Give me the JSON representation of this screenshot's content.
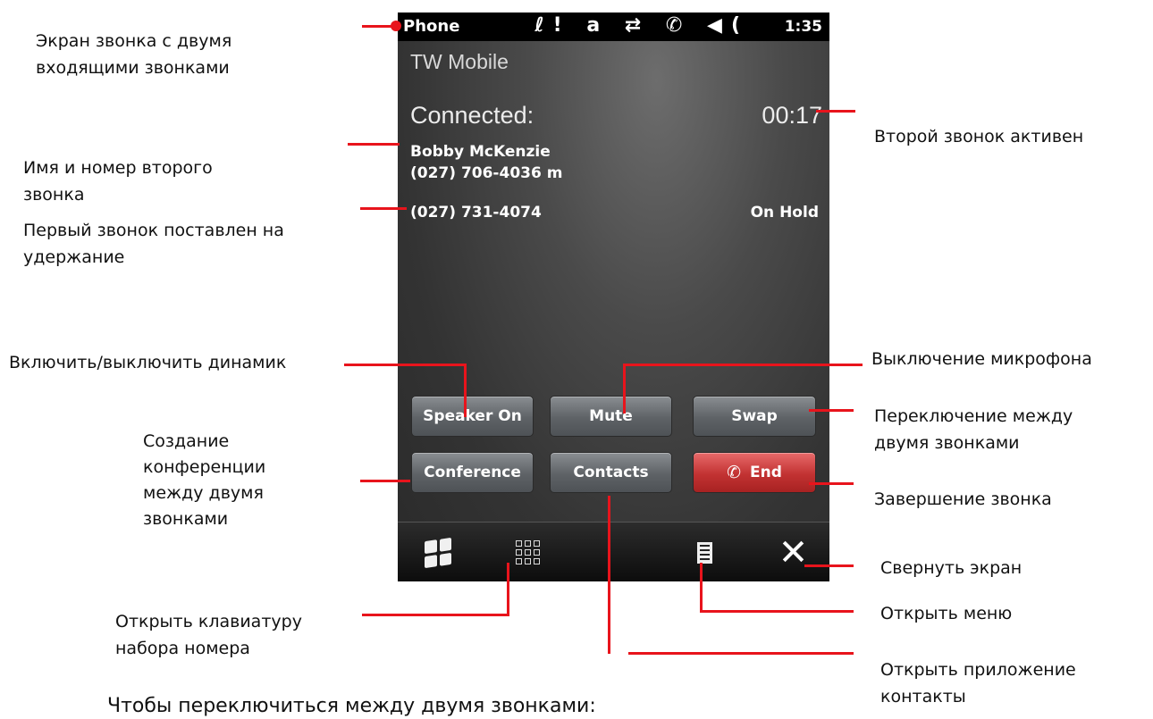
{
  "phone": {
    "status_title": "Phone",
    "status_icons": "ℓ! a ⇄ ✆ ◀(",
    "clock": "1:35",
    "carrier": "TW Mobile",
    "connected_label": "Connected:",
    "call_timer": "00:17",
    "active_call_name": "Bobby McKenzie",
    "active_call_number": "(027) 706-4036 m",
    "held_call_number": "(027) 731-4074",
    "held_status": "On Hold",
    "buttons": {
      "speaker": "Speaker On",
      "mute": "Mute",
      "swap": "Swap",
      "conference": "Conference",
      "contacts": "Contacts",
      "end": "End"
    },
    "toolbar_icons": [
      "windows-start-icon",
      "keypad-icon",
      "menu-icon",
      "close-icon"
    ]
  },
  "annotations": {
    "screen_l1": "Экран звонка с двумя",
    "screen_l2": "входящими звонками",
    "second_active": "Второй звонок активен",
    "name_l1": "Имя и номер второго",
    "name_l2": "звонка",
    "hold_l1": "Первый звонок поставлен на",
    "hold_l2": "удержание",
    "speaker": "Включить/выключить динамик",
    "mute": "Выключение микрофона",
    "swap_l1": "Переключение между",
    "swap_l2": "двумя звонками",
    "conf_l1": "Создание",
    "conf_l2": "конференции",
    "conf_l3": "между двумя",
    "conf_l4": "звонками",
    "end": "Завершение звонка",
    "minimize": "Свернуть экран",
    "menu": "Открыть меню",
    "keypad_l1": "Открыть клавиатуру",
    "keypad_l2": "набора номера",
    "contacts_l1": "Открыть приложение",
    "contacts_l2": "контакты",
    "footer": "Чтобы переключиться между двумя звонками:"
  },
  "colors": {
    "callout": "#e8141c",
    "end_button": "#c23232"
  }
}
